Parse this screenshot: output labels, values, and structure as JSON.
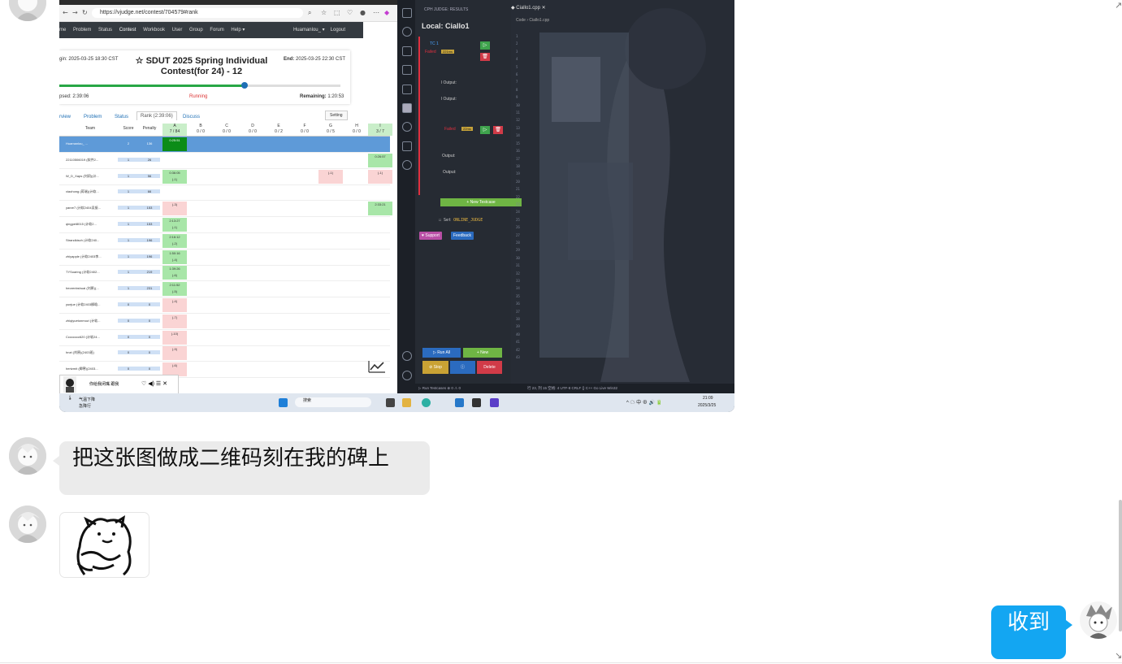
{
  "screenshot": {
    "browser": {
      "url": "https://vjudge.net/contest/704579#rank",
      "nav_items": [
        "me",
        "Problem",
        "Status",
        "Contest",
        "Workbook",
        "User",
        "Group",
        "Forum",
        "Help ▾"
      ],
      "user": "Huamanlou_ ▾",
      "logout": "Logout",
      "begin": "gin: 2025-03-25 18:30 CST",
      "end_label": "End:",
      "end": "2025-03-25 22:30 CST",
      "title": "☆ SDUT 2025 Spring Individual Contest(for 24) - 12",
      "elapsed": "psed: 2:39:06",
      "status": "Running",
      "remaining_label": "Remaining:",
      "remaining": "1:20:53",
      "progress": 0.66,
      "tabs": [
        "rview",
        "Problem",
        "Status",
        "Rank (2:39:06)",
        "Discuss"
      ],
      "setting": "Setting",
      "headers": {
        "team": "Team",
        "score": "Score",
        "penalty": "Penalty",
        "problems": [
          {
            "id": "A",
            "ratio": "7 / 84"
          },
          {
            "id": "B",
            "ratio": "0 / 0"
          },
          {
            "id": "C",
            "ratio": "0 / 0"
          },
          {
            "id": "D",
            "ratio": "0 / 0"
          },
          {
            "id": "E",
            "ratio": "0 / 2"
          },
          {
            "id": "F",
            "ratio": "0 / 0"
          },
          {
            "id": "G",
            "ratio": "0 / 5"
          },
          {
            "id": "H",
            "ratio": "0 / 0"
          },
          {
            "id": "I",
            "ratio": "3 / 7"
          }
        ]
      },
      "rows": [
        {
          "team": "Huamanlou_ ...",
          "score": "2",
          "penalty": "136",
          "a": "0:25:51",
          "g": "",
          "i": ""
        },
        {
          "team": "22110506019 (软件2...",
          "score": "1",
          "penalty": "26",
          "a": "",
          "g": "",
          "i": "0:26:57"
        },
        {
          "team": "W_D_Xaps (刘润)(计...",
          "score": "1",
          "penalty": "56",
          "a": "0:36:05 (-1)",
          "g": "(-1)",
          "i": "(-1)"
        },
        {
          "team": "xiaohong (蒋瑞)(计软...",
          "score": "1",
          "penalty": "66",
          "a": "",
          "g": "",
          "i": ""
        },
        {
          "team": "yanre7 (计软2404吴振...",
          "score": "1",
          "penalty": "153",
          "a": "(-3)",
          "g": "",
          "i": "2:33:21"
        },
        {
          "team": "qingpei8015 (计软2...",
          "score": "1",
          "penalty": "153",
          "a": "2:13:27 (-1)",
          "g": "",
          "i": ""
        },
        {
          "team": "Strandkisch (计软240...",
          "score": "1",
          "penalty": "196",
          "a": "2:16:12 (-2)",
          "g": "",
          "i": ""
        },
        {
          "team": "zhiyapple (计软2403李...",
          "score": "1",
          "penalty": "196",
          "a": "1:50:16 (-4)",
          "g": "",
          "i": ""
        },
        {
          "team": "TYSoaring (计软2402...",
          "score": "1",
          "penalty": "219",
          "a": "1:39:26 (-6)",
          "g": "",
          "i": ""
        },
        {
          "team": "heorenbshuai (刘原)(...",
          "score": "1",
          "penalty": "231",
          "a": "2:11:52 (-5)",
          "g": "",
          "i": ""
        },
        {
          "team": "yuejue (计软2403柳晗...",
          "score": "0",
          "penalty": "0",
          "a": "(-4)",
          "g": "",
          "i": ""
        },
        {
          "team": "zhiqiyuetonmozi (计软...",
          "score": "0",
          "penalty": "0",
          "a": "(-7)",
          "g": "",
          "i": ""
        },
        {
          "team": "Cccccccc620 (计软24...",
          "score": "0",
          "penalty": "0",
          "a": "(-10)",
          "g": "",
          "i": ""
        },
        {
          "team": "hnzt (刘原)(2403班)",
          "score": "0",
          "penalty": "0",
          "a": "(-9)",
          "g": "",
          "i": ""
        },
        {
          "team": "hertzmit (卿寒)(2403...",
          "score": "0",
          "penalty": "0",
          "a": "(-6)",
          "g": "",
          "i": ""
        }
      ],
      "popup_text": "你给我闭嘴  跟我"
    },
    "editor": {
      "panel_title": "CPH JUDGE: RESULTS",
      "local": "Local: Ciallo1",
      "tc": "TC 1",
      "failed": "Failed",
      "ms": "221ms",
      "ms2": "22ms",
      "input": "Input:",
      "exp_output": "l Output:",
      "rcv_output": "l Output:",
      "output": "Output:",
      "new_testcase": "+ New Testcase",
      "set_oj": "Set",
      "oj_code": "ONLINE_JUDGE",
      "support": "♥ Support",
      "feedback": "Feedback",
      "file_tab": "Ciallo1.cpp",
      "breadcrumb": "Code › Ciallo1.cpp",
      "run_all": "▷ Run All",
      "new": "+ New",
      "stop": "⊘ Stop",
      "delete": "Delete",
      "status_left": "▷ Run Testcases  ⊗ 0 ⚠ 0",
      "status_right": "行 23, 列 15  空格: 4  UTF-8  CRLF  {} C++  Go Live  Win32",
      "line_numbers": [
        "1",
        "2",
        "3",
        "4",
        "5",
        "6",
        "7",
        "8",
        "9",
        "10",
        "11",
        "12",
        "13",
        "14",
        "15",
        "16",
        "17",
        "18",
        "19",
        "20",
        "21",
        "22",
        "23",
        "24",
        "25",
        "26",
        "27",
        "28",
        "29",
        "30",
        "31",
        "32",
        "33",
        "34",
        "35",
        "36",
        "37",
        "38",
        "39",
        "40",
        "41",
        "42",
        "43"
      ]
    },
    "taskbar": {
      "weather": "气温下降",
      "weather_sub": "急降行",
      "search": "搜索",
      "time": "21:09",
      "date": "2025/3/25",
      "tray": "^ ☁ 中 ⊕ 🔊 🔋"
    }
  },
  "messages": {
    "text1": "把这张图做成二维码刻在我的碑上",
    "reply": "收到"
  },
  "colors": {
    "my_bubble": "#13a6f2",
    "their_bubble": "#ebebeb"
  }
}
